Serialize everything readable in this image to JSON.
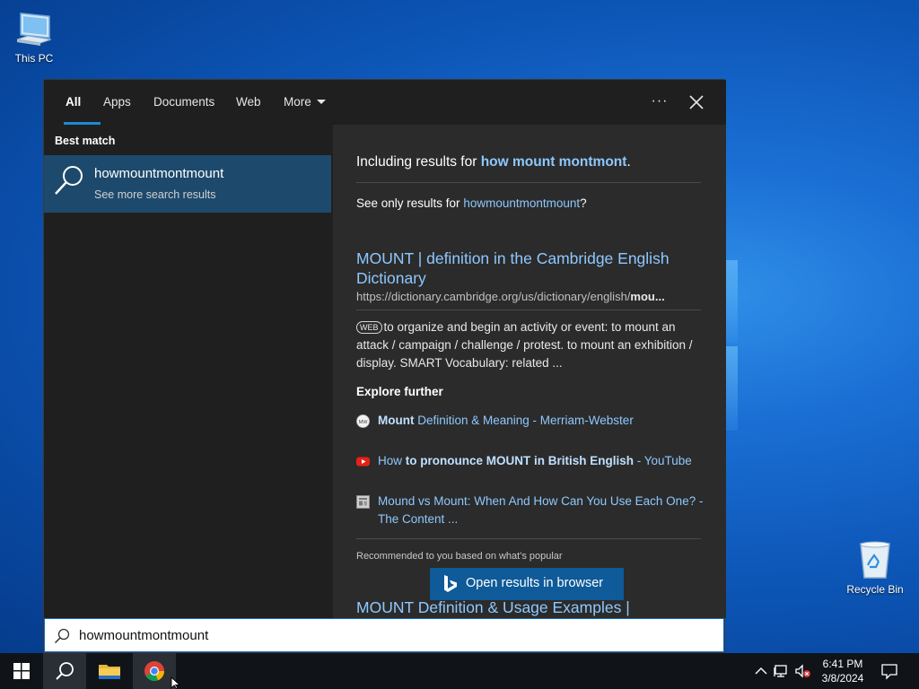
{
  "desktop": {
    "icons": [
      {
        "label": "This PC",
        "icon": "computer-icon"
      },
      {
        "label": "Recycle Bin",
        "icon": "recycle-bin-icon"
      }
    ]
  },
  "search": {
    "tabs": [
      {
        "label": "All",
        "active": true
      },
      {
        "label": "Apps"
      },
      {
        "label": "Documents"
      },
      {
        "label": "Web"
      },
      {
        "label": "More"
      }
    ],
    "more_options_label": "···",
    "best_match": {
      "heading": "Best match",
      "title": "howmountmontmount",
      "subtitle": "See more search results"
    },
    "right": {
      "including_prefix": "Including results for ",
      "including_query": "how mount montmont",
      "including_suffix": ".",
      "see_only_prefix": "See only results for ",
      "see_only_query": "howmountmontmount",
      "see_only_suffix": "?",
      "result_title": "MOUNT | definition in the Cambridge English Dictionary",
      "result_url_prefix": "https://dictionary.cambridge.org/us/dictionary/english/",
      "result_url_bold": "mou...",
      "result_badge": "WEB",
      "result_snippet": "to organize and begin an activity or event: to mount an attack / campaign / challenge / protest. to mount an exhibition / display. SMART Vocabulary: related ...",
      "explore_heading": "Explore further",
      "explore": [
        {
          "bold": "Mount",
          "text": " Definition & Meaning - Merriam-Webster",
          "icon": "merriam-webster-icon"
        },
        {
          "pre": "How ",
          "bold": "to pronounce MOUNT in British English",
          "text": " - YouTube",
          "icon": "youtube-icon"
        },
        {
          "text": "Mound vs Mount: When And How Can You Use Each One? - The Content ...",
          "icon": "web-page-icon"
        }
      ],
      "recommended": "Recommended to you based on what's popular",
      "next_result": "MOUNT Definition & Usage Examples |",
      "open_browser": "Open results in browser"
    },
    "input_value": "howmountmontmount"
  },
  "taskbar": {
    "time": "6:41 PM",
    "date": "3/8/2024"
  },
  "colors": {
    "accent": "#1a8ad4",
    "link": "#8ec8ff",
    "selection": "#1d4a6c",
    "button": "#0f5a98"
  }
}
